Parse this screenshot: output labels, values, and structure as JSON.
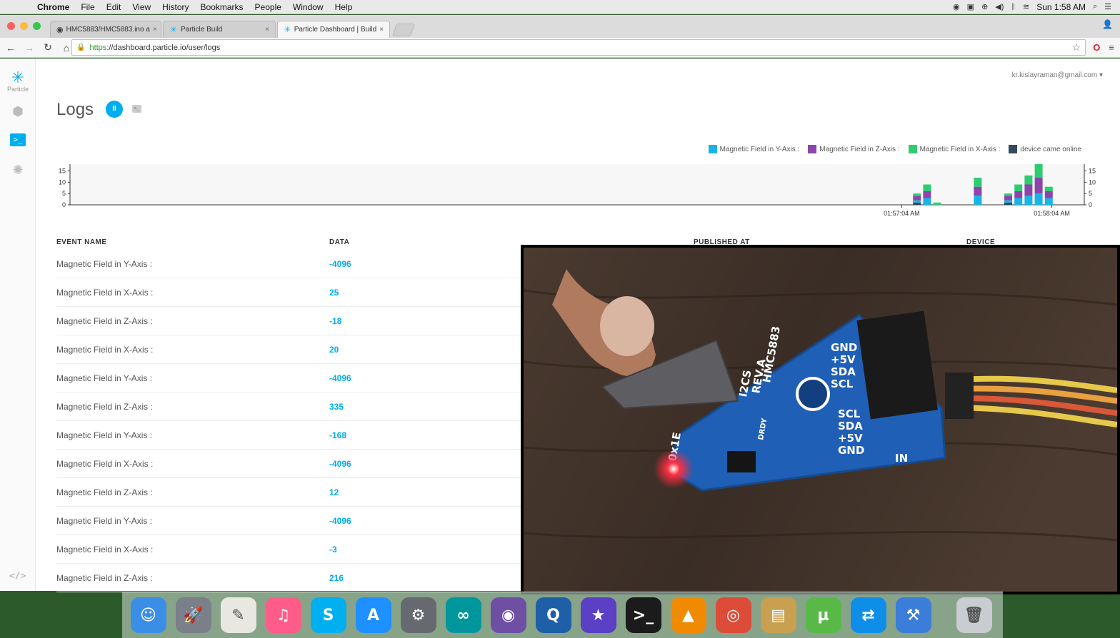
{
  "menubar": {
    "app": "Chrome",
    "items": [
      "File",
      "Edit",
      "View",
      "History",
      "Bookmarks",
      "People",
      "Window",
      "Help"
    ],
    "clock": "Sun 1:58 AM"
  },
  "tabs": [
    {
      "label": "HMC5883/HMC5883.ino a",
      "icon": "github-icon"
    },
    {
      "label": "Particle Build",
      "icon": "particle-icon"
    },
    {
      "label": "Particle Dashboard | Build",
      "icon": "particle-icon"
    }
  ],
  "address": {
    "scheme": "https",
    "rest": "://dashboard.particle.io/user/logs"
  },
  "sidebar": {
    "logo_label": "Particle",
    "console_glyph": ">_",
    "code_glyph": "</>"
  },
  "page": {
    "user_email": "kr.kislayraman@gmail.com",
    "title": "Logs",
    "pause_glyph": "II"
  },
  "colors": {
    "y_axis": "#1ab3e6",
    "z_axis": "#8e44ad",
    "x_axis": "#2ecc71",
    "online": "#34495e",
    "accent": "#00aeef"
  },
  "chart_data": {
    "type": "bar",
    "stacked": true,
    "legend": [
      "Magnetic Field in Y-Axis :",
      "Magnetic Field in Z-Axis :",
      "Magnetic Field in X-Axis :",
      "device came online"
    ],
    "legend_placement": "top-right",
    "y_ticks": [
      "0",
      "5",
      "10",
      "15"
    ],
    "x_ticks": [
      "01:57:04 AM",
      "01:58:04 AM"
    ],
    "ylim": [
      0,
      18
    ],
    "bars": [
      {
        "t": 0.835,
        "y": 1,
        "z": 2,
        "x": 1,
        "online": 1
      },
      {
        "t": 0.845,
        "y": 3,
        "z": 3,
        "x": 3,
        "online": 0
      },
      {
        "t": 0.855,
        "y": 0,
        "z": 0,
        "x": 1,
        "online": 0
      },
      {
        "t": 0.895,
        "y": 4,
        "z": 4,
        "x": 4,
        "online": 0
      },
      {
        "t": 0.925,
        "y": 1,
        "z": 2,
        "x": 1,
        "online": 1
      },
      {
        "t": 0.935,
        "y": 3,
        "z": 3,
        "x": 3,
        "online": 0
      },
      {
        "t": 0.945,
        "y": 4,
        "z": 5,
        "x": 4,
        "online": 0
      },
      {
        "t": 0.955,
        "y": 5,
        "z": 7,
        "x": 6,
        "online": 0
      },
      {
        "t": 0.965,
        "y": 3,
        "z": 3,
        "x": 2,
        "online": 0
      }
    ]
  },
  "table": {
    "headers": [
      "EVENT NAME",
      "DATA",
      "PUBLISHED AT",
      "DEVICE"
    ],
    "rows": [
      {
        "event": "Magnetic Field in Y-Axis :",
        "data": "-4096"
      },
      {
        "event": "Magnetic Field in X-Axis :",
        "data": "25"
      },
      {
        "event": "Magnetic Field in Z-Axis :",
        "data": "-18"
      },
      {
        "event": "Magnetic Field in X-Axis :",
        "data": "20"
      },
      {
        "event": "Magnetic Field in Y-Axis :",
        "data": "-4096"
      },
      {
        "event": "Magnetic Field in Z-Axis :",
        "data": "335"
      },
      {
        "event": "Magnetic Field in Y-Axis :",
        "data": "-168"
      },
      {
        "event": "Magnetic Field in X-Axis :",
        "data": "-4096"
      },
      {
        "event": "Magnetic Field in Z-Axis :",
        "data": "12"
      },
      {
        "event": "Magnetic Field in Y-Axis :",
        "data": "-4096"
      },
      {
        "event": "Magnetic Field in X-Axis :",
        "data": "-3"
      },
      {
        "event": "Magnetic Field in Z-Axis :",
        "data": "216"
      }
    ]
  },
  "video": {
    "board_labels": [
      "HMC5883",
      "REV.A",
      "I2CS",
      "GND",
      "+5V",
      "SDA",
      "SCL",
      "DRDY",
      "0x1E",
      "IN"
    ]
  },
  "dock": [
    {
      "name": "finder-icon",
      "glyph": "☺",
      "color": "#3a8ee6"
    },
    {
      "name": "launchpad-icon",
      "glyph": "🚀",
      "color": "#7a7f8a"
    },
    {
      "name": "textedit-icon",
      "glyph": "✎",
      "color": "#e8e8e0"
    },
    {
      "name": "itunes-icon",
      "glyph": "♫",
      "color": "#ff5c8a"
    },
    {
      "name": "skype-icon",
      "glyph": "S",
      "color": "#00aff0"
    },
    {
      "name": "app-store-icon",
      "glyph": "A",
      "color": "#1e90ff"
    },
    {
      "name": "system-preferences-icon",
      "glyph": "⚙",
      "color": "#666a70"
    },
    {
      "name": "arduino-icon",
      "glyph": "∞",
      "color": "#00979c"
    },
    {
      "name": "github-desktop-icon",
      "glyph": "◉",
      "color": "#6e4fa3"
    },
    {
      "name": "quicktime-icon",
      "glyph": "Q",
      "color": "#1f5fa8"
    },
    {
      "name": "imovie-icon",
      "glyph": "★",
      "color": "#5b3fc4"
    },
    {
      "name": "terminal-icon",
      "glyph": ">_",
      "color": "#1b1b1b"
    },
    {
      "name": "vlc-icon",
      "glyph": "▲",
      "color": "#f08a00"
    },
    {
      "name": "chrome-icon",
      "glyph": "◎",
      "color": "#dd4b39"
    },
    {
      "name": "archive-utility-icon",
      "glyph": "▤",
      "color": "#c8a050"
    },
    {
      "name": "utorrent-icon",
      "glyph": "µ",
      "color": "#58b947"
    },
    {
      "name": "teamviewer-icon",
      "glyph": "⇄",
      "color": "#0e8ee9"
    },
    {
      "name": "xcode-icon",
      "glyph": "⚒",
      "color": "#3b7dd8"
    },
    {
      "name": "trash-icon",
      "glyph": "🗑",
      "color": "#c9cdd2"
    }
  ]
}
